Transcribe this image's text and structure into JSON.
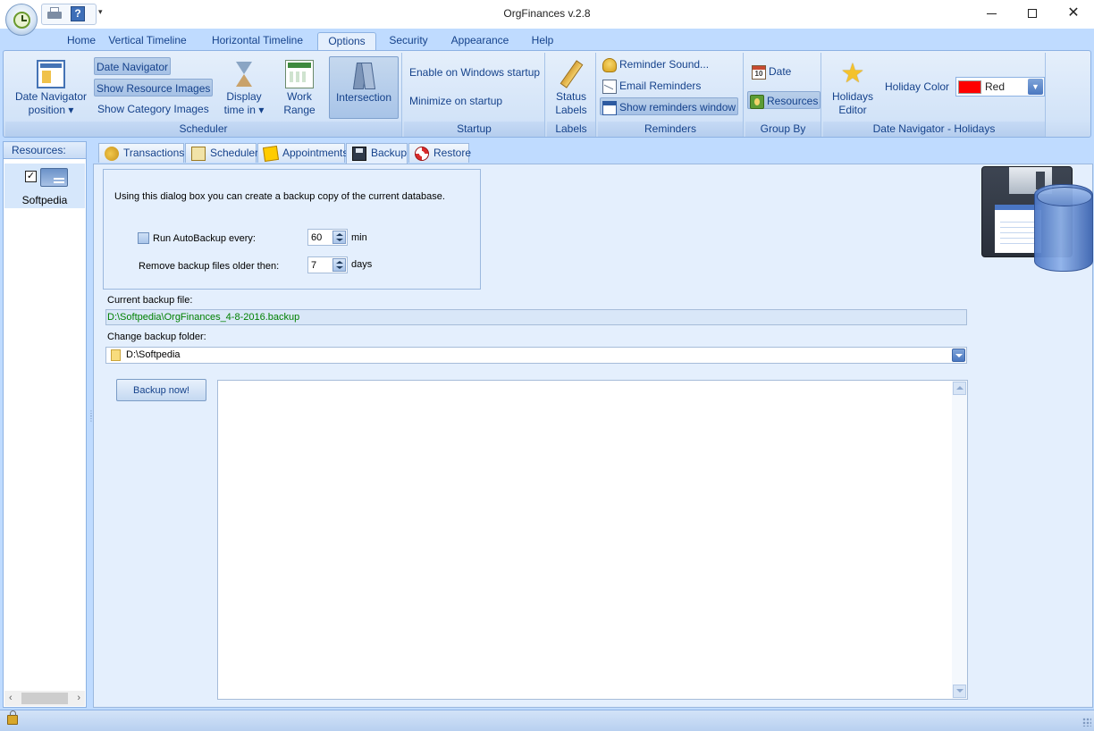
{
  "window": {
    "title": "OrgFinances v.2.8",
    "controls": {
      "minimize": "—",
      "maximize": "☐",
      "close": "✕"
    }
  },
  "quick_access": {
    "dropdown_glyph": "▾"
  },
  "ribbon_tabs": [
    {
      "label": "Home"
    },
    {
      "label": "Vertical Timeline"
    },
    {
      "label": "Horizontal Timeline"
    },
    {
      "label": "Options",
      "active": true
    },
    {
      "label": "Security"
    },
    {
      "label": "Appearance"
    },
    {
      "label": "Help"
    }
  ],
  "ribbon": {
    "scheduler": {
      "group_label": "Scheduler",
      "date_navigator_position": "Date Navigator position ▾",
      "date_navigator": "Date Navigator",
      "show_resource_images": "Show Resource Images",
      "show_category_images": "Show Category Images",
      "display_time_in": "Display time in ▾",
      "work_range": "Work Range",
      "intersection": "Intersection"
    },
    "startup": {
      "group_label": "Startup",
      "enable_on_windows_startup": "Enable on Windows startup",
      "minimize_on_startup": "Minimize on startup"
    },
    "labels": {
      "group_label": "Labels",
      "status_labels": "Status Labels"
    },
    "reminders": {
      "group_label": "Reminders",
      "reminder_sound": "Reminder Sound...",
      "email_reminders": "Email Reminders",
      "show_reminders_window": "Show reminders window"
    },
    "group_by": {
      "group_label": "Group By",
      "date": "Date",
      "resources": "Resources",
      "calendar_day": "10"
    },
    "holidays": {
      "group_label": "Date Navigator - Holidays",
      "holidays_editor": "Holidays Editor",
      "holiday_color_label": "Holiday Color",
      "holiday_color_value": "Red",
      "holiday_color_hex": "#ff0000"
    }
  },
  "resources_panel": {
    "header": "Resources:",
    "items": [
      {
        "name": "Softpedia",
        "checked": true,
        "check_glyph": "✓"
      }
    ]
  },
  "doc_tabs": [
    {
      "label": "Transactions"
    },
    {
      "label": "Scheduler"
    },
    {
      "label": "Appointments"
    },
    {
      "label": "Backup",
      "active": true
    },
    {
      "label": "Restore"
    }
  ],
  "backup": {
    "intro": "Using this dialog box you can create a backup copy of the current database.",
    "autobackup_label": "Run AutoBackup every:",
    "autobackup_value": "60",
    "autobackup_unit": "min",
    "autobackup_checked": false,
    "remove_label": "Remove backup files older then:",
    "remove_value": "7",
    "remove_unit": "days",
    "current_file_label": "Current backup file:",
    "current_file": "D:\\Softpedia\\OrgFinances_4-8-2016.backup",
    "change_folder_label": "Change backup folder:",
    "folder": "D:\\Softpedia",
    "backup_button": "Backup now!"
  },
  "colors": {
    "accent": "#15428b",
    "ribbon_bg": "#bfdbff",
    "file_text": "#008000"
  }
}
